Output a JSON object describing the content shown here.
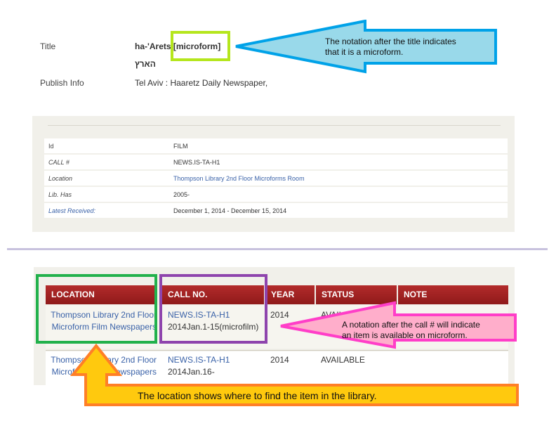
{
  "record": {
    "title_label": "Title",
    "title_main": "ha-'Arets",
    "title_gmd": "[microform]",
    "title_hebrew": "הארץ",
    "publish_label": "Publish Info",
    "publish_value": "Tel Aviv : Haaretz Daily Newspaper,"
  },
  "holdings": [
    {
      "key": "Id",
      "value": "FILM"
    },
    {
      "key": "CALL #",
      "value": "NEWS.IS-TA-H1"
    },
    {
      "key": "Location",
      "value": "Thompson Library 2nd Floor Microforms Room"
    },
    {
      "key": "Lib. Has",
      "value": "2005-"
    },
    {
      "key": "Latest Received:",
      "value": "December 1, 2014 - December 15, 2014"
    }
  ],
  "items_table": {
    "headers": [
      "LOCATION",
      "CALL NO.",
      "YEAR",
      "STATUS",
      "NOTE"
    ],
    "rows": [
      {
        "location_1": "Thompson Library 2nd Floor",
        "location_2": "Microform Film Newspapers",
        "call_1": "NEWS.IS-TA-H1",
        "call_2": "2014Jan.1-15(microfilm)",
        "year": "2014",
        "status": "AVAILABLE"
      },
      {
        "location_1": "Thompson Library 2nd Floor",
        "location_2": "Microform Film Newspapers",
        "call_1": "NEWS.IS-TA-H1",
        "call_2": "2014Jan.16-",
        "year": "2014",
        "status": "AVAILABLE"
      }
    ]
  },
  "annotations": {
    "title_note_1": "The notation after the title indicates",
    "title_note_2": "that it is a microform.",
    "call_note_1": "A notation after the call # will indicate",
    "call_note_2": "an item is available on microform.",
    "location_note": "The location shows where to find the item in the library."
  },
  "colors": {
    "header_red": "#a32222",
    "link_blue": "#3a62a8",
    "title_highlight": "#b5e61d",
    "title_callout": "#00a2e8",
    "call_highlight": "#8e44ad",
    "call_callout": "#ff3ec8",
    "location_highlight": "#22b14c",
    "location_callout": "#ff7f27"
  }
}
